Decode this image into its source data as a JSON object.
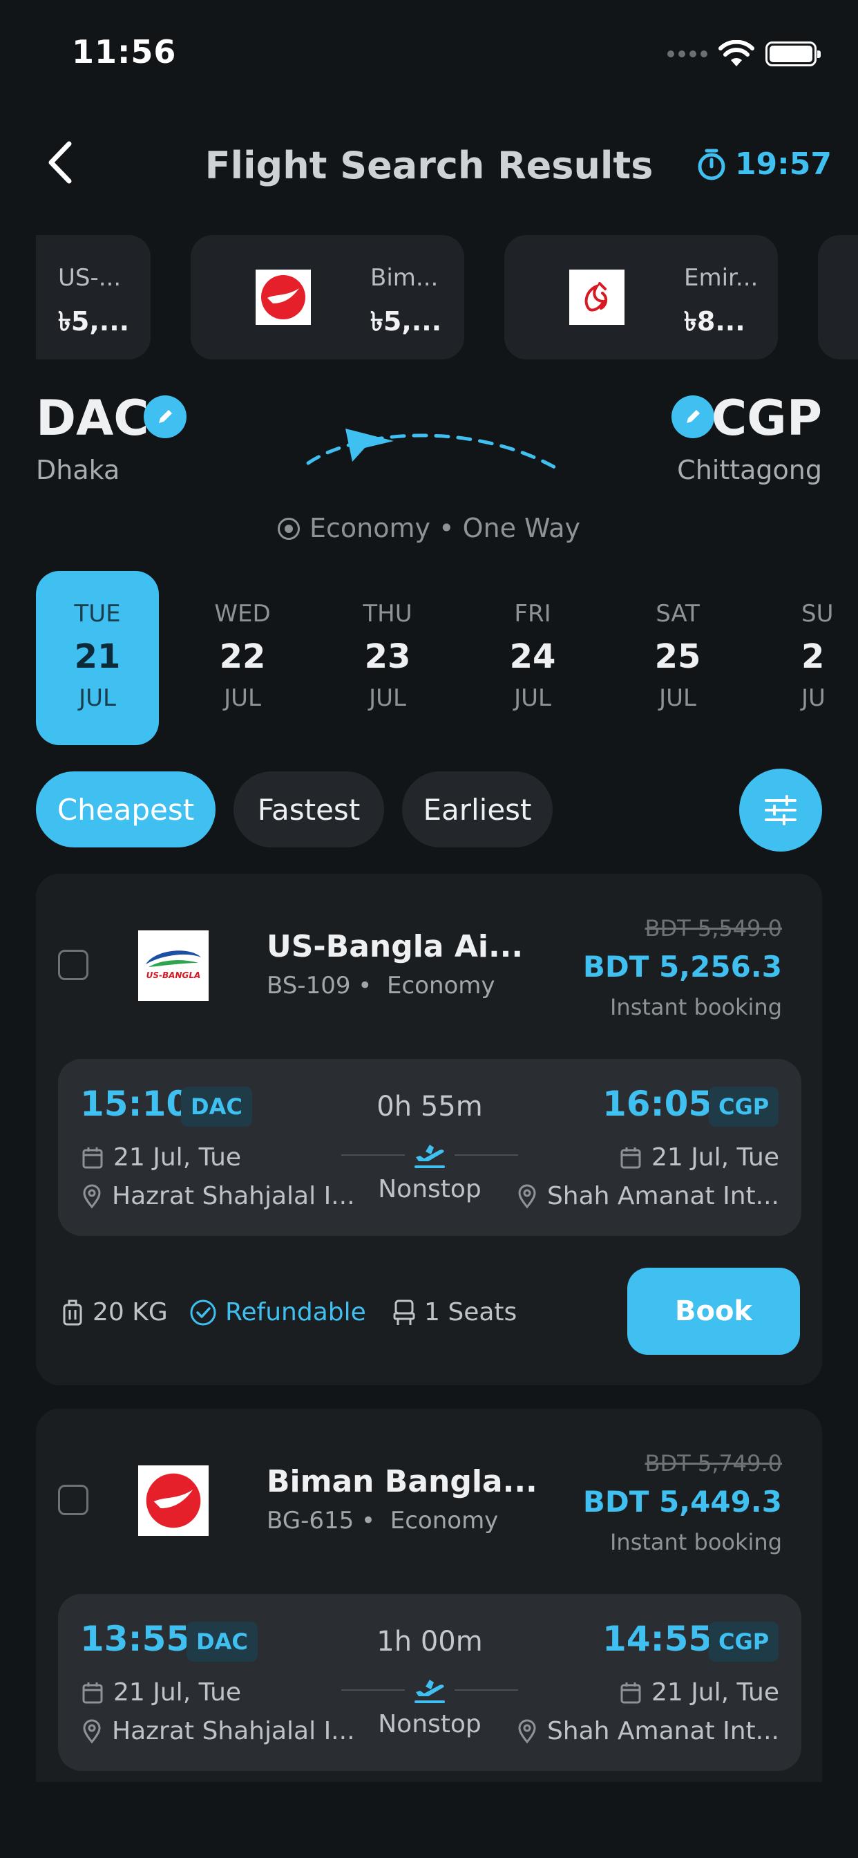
{
  "status": {
    "time": "11:56"
  },
  "header": {
    "title": "Flight Search Results",
    "timer": "19:57"
  },
  "airline_chips": [
    {
      "name": "US-...",
      "price": "৳5,..."
    },
    {
      "name": "Bim...",
      "price": "৳5,..."
    },
    {
      "name": "Emir...",
      "price": "৳8..."
    }
  ],
  "route": {
    "from_code": "DAC",
    "from_city": "Dhaka",
    "to_code": "CGP",
    "to_city": "Chittagong",
    "cabin": "Economy • One Way"
  },
  "dates": [
    {
      "dow": "TUE",
      "day": "21",
      "month": "JUL"
    },
    {
      "dow": "WED",
      "day": "22",
      "month": "JUL"
    },
    {
      "dow": "THU",
      "day": "23",
      "month": "JUL"
    },
    {
      "dow": "FRI",
      "day": "24",
      "month": "JUL"
    },
    {
      "dow": "SAT",
      "day": "25",
      "month": "JUL"
    },
    {
      "dow": "SU",
      "day": "2",
      "month": "JU"
    }
  ],
  "sort": {
    "cheapest": "Cheapest",
    "fastest": "Fastest",
    "earliest": "Earliest"
  },
  "flights": [
    {
      "airline": "US-Bangla Ai...",
      "flight_no": "BS-109",
      "cabin": "Economy",
      "old_price": "BDT 5,549.0",
      "price": "BDT 5,256.3",
      "booking": "Instant booking",
      "dep_time": "15:10",
      "dep_code": "DAC",
      "arr_time": "16:05",
      "arr_code": "CGP",
      "duration": "0h 55m",
      "dep_date": "21 Jul, Tue",
      "arr_date": "21 Jul, Tue",
      "dep_airport": "Hazrat Shahjalal I...",
      "arr_airport": "Shah Amanat Int...",
      "stops": "Nonstop",
      "baggage": "20 KG",
      "refund": "Refundable",
      "seats": "1 Seats",
      "book": "Book"
    },
    {
      "airline": "Biman Bangla...",
      "flight_no": "BG-615",
      "cabin": "Economy",
      "old_price": "BDT 5,749.0",
      "price": "BDT 5,449.3",
      "booking": "Instant booking",
      "dep_time": "13:55",
      "dep_code": "DAC",
      "arr_time": "14:55",
      "arr_code": "CGP",
      "duration": "1h 00m",
      "dep_date": "21 Jul, Tue",
      "arr_date": "21 Jul, Tue",
      "dep_airport": "Hazrat Shahjalal I...",
      "arr_airport": "Shah Amanat Int...",
      "stops": "Nonstop"
    }
  ],
  "colors": {
    "accent": "#3fc0f1",
    "background": "#121518",
    "card": "#1b1e21"
  }
}
